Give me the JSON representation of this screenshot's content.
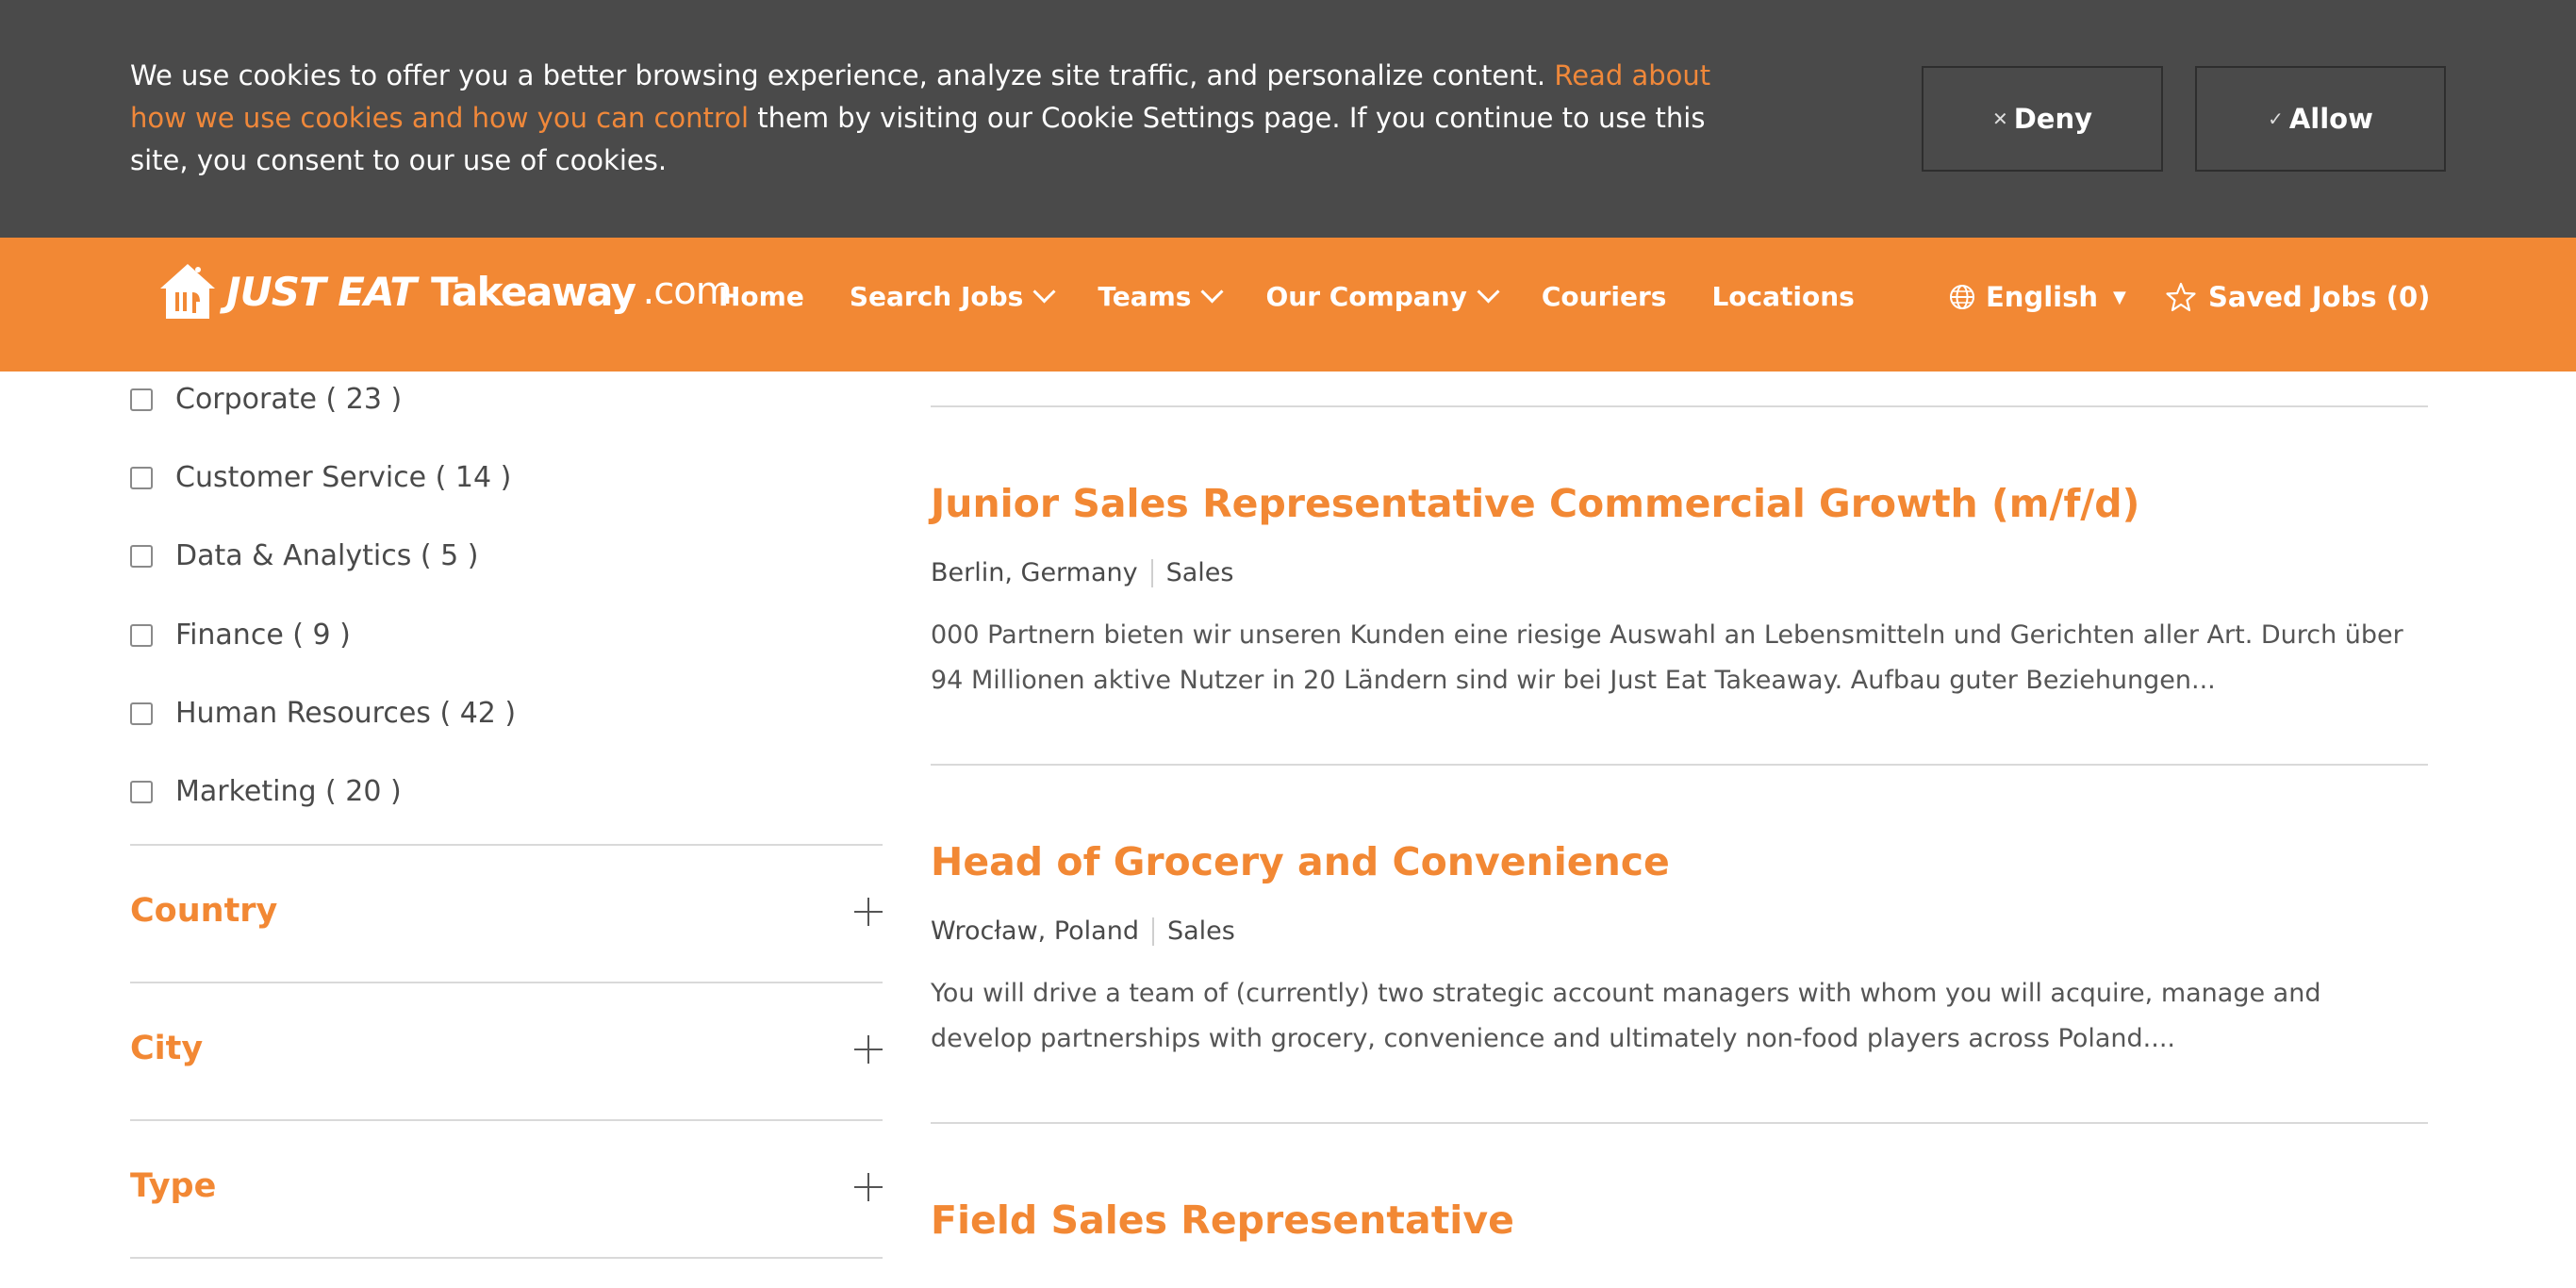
{
  "cookie_banner": {
    "text_before_link": "We use cookies to offer you a better browsing experience, analyze site traffic, and personalize content. ",
    "link_text": "Read about how we use cookies and how you can control",
    "text_after_link": " them by visiting our Cookie Settings page. If you continue to use this site, you consent to our use of cookies.",
    "deny_label": "Deny",
    "allow_label": "Allow",
    "link_color": "#f0883a",
    "background_color": "#4a4a4a"
  },
  "header": {
    "brand_color": "#f28834",
    "logo": {
      "just_eat": "JUST EAT",
      "takeaway": "Takeaway",
      "com": ".com"
    },
    "nav": {
      "home": "Home",
      "search_jobs": "Search Jobs",
      "teams": "Teams",
      "our_company": "Our Company",
      "couriers": "Couriers",
      "locations": "Locations"
    },
    "language": "English",
    "saved_jobs": "Saved Jobs (0)"
  },
  "sidebar": {
    "categories": [
      "Corporate ( 23 )",
      "Customer Service ( 14 )",
      "Data & Analytics ( 5 )",
      "Finance ( 9 )",
      "Human Resources ( 42 )",
      "Marketing ( 20 )"
    ],
    "accordions": [
      "Country",
      "City",
      "Type"
    ]
  },
  "jobs": [
    {
      "title": "Junior Sales Representative Commercial Growth (m/f/d)",
      "location": "Berlin, Germany",
      "team": "Sales",
      "description": "000 Partnern bieten wir unseren Kunden eine riesige Auswahl an Lebensmitteln und Gerichten aller Art. Durch über 94 Millionen aktive Nutzer in 20 Ländern sind wir bei Just Eat Takeaway. Aufbau guter Beziehungen..."
    },
    {
      "title": "Head of Grocery and Convenience",
      "location": "Wrocław, Poland",
      "team": "Sales",
      "description": "You will drive a team of (currently) two strategic account managers with whom you will acquire, manage and develop partnerships with grocery, convenience and ultimately non-food players across Poland...."
    },
    {
      "title": "Field Sales Representative"
    }
  ]
}
